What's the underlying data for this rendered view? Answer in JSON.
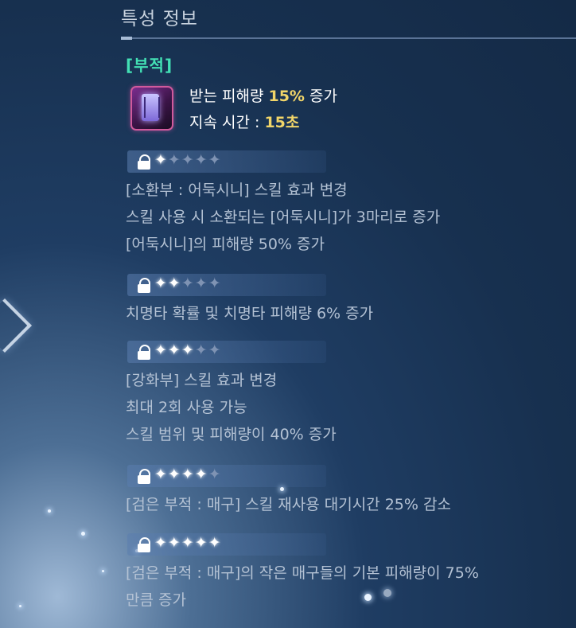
{
  "panel": {
    "title": "특성 정보",
    "category": "[부적]",
    "effect": {
      "line1_prefix": "받는 피해량 ",
      "line1_value": "15%",
      "line1_suffix": " 증가",
      "line2_prefix": "지속 시간 : ",
      "line2_value": "15초"
    },
    "tiers": [
      {
        "stars_filled": 1,
        "stars_total": 5,
        "lines": [
          "[소환부 : 어둑시니] 스킬 효과 변경",
          "스킬 사용 시 소환되는 [어둑시니]가 3마리로 증가",
          "[어둑시니]의 피해량 50% 증가"
        ]
      },
      {
        "stars_filled": 2,
        "stars_total": 5,
        "lines": [
          "치명타 확률 및 치명타 피해량 6% 증가"
        ]
      },
      {
        "stars_filled": 3,
        "stars_total": 5,
        "lines": [
          "[강화부] 스킬 효과 변경",
          "최대 2회 사용 가능",
          "스킬 범위 및 피해량이 40% 증가"
        ]
      },
      {
        "stars_filled": 4,
        "stars_total": 5,
        "lines": [
          "[검은 부적 : 매구] 스킬 재사용 대기시간 25% 감소"
        ]
      },
      {
        "stars_filled": 5,
        "stars_total": 5,
        "lines": [
          "[검은 부적 : 매구]의 작은 매구들의 기본 피해량이 75%",
          "만큼 증가"
        ]
      }
    ]
  },
  "colors": {
    "category": "#43e0b4",
    "highlight": "#f1d569",
    "star_on": "#ffffff",
    "star_off": "#7f93b3"
  },
  "icons": {
    "talisman": "talisman-icon",
    "lock": "lock-icon",
    "star": "star-icon",
    "nav": "chevron-right-icon"
  }
}
